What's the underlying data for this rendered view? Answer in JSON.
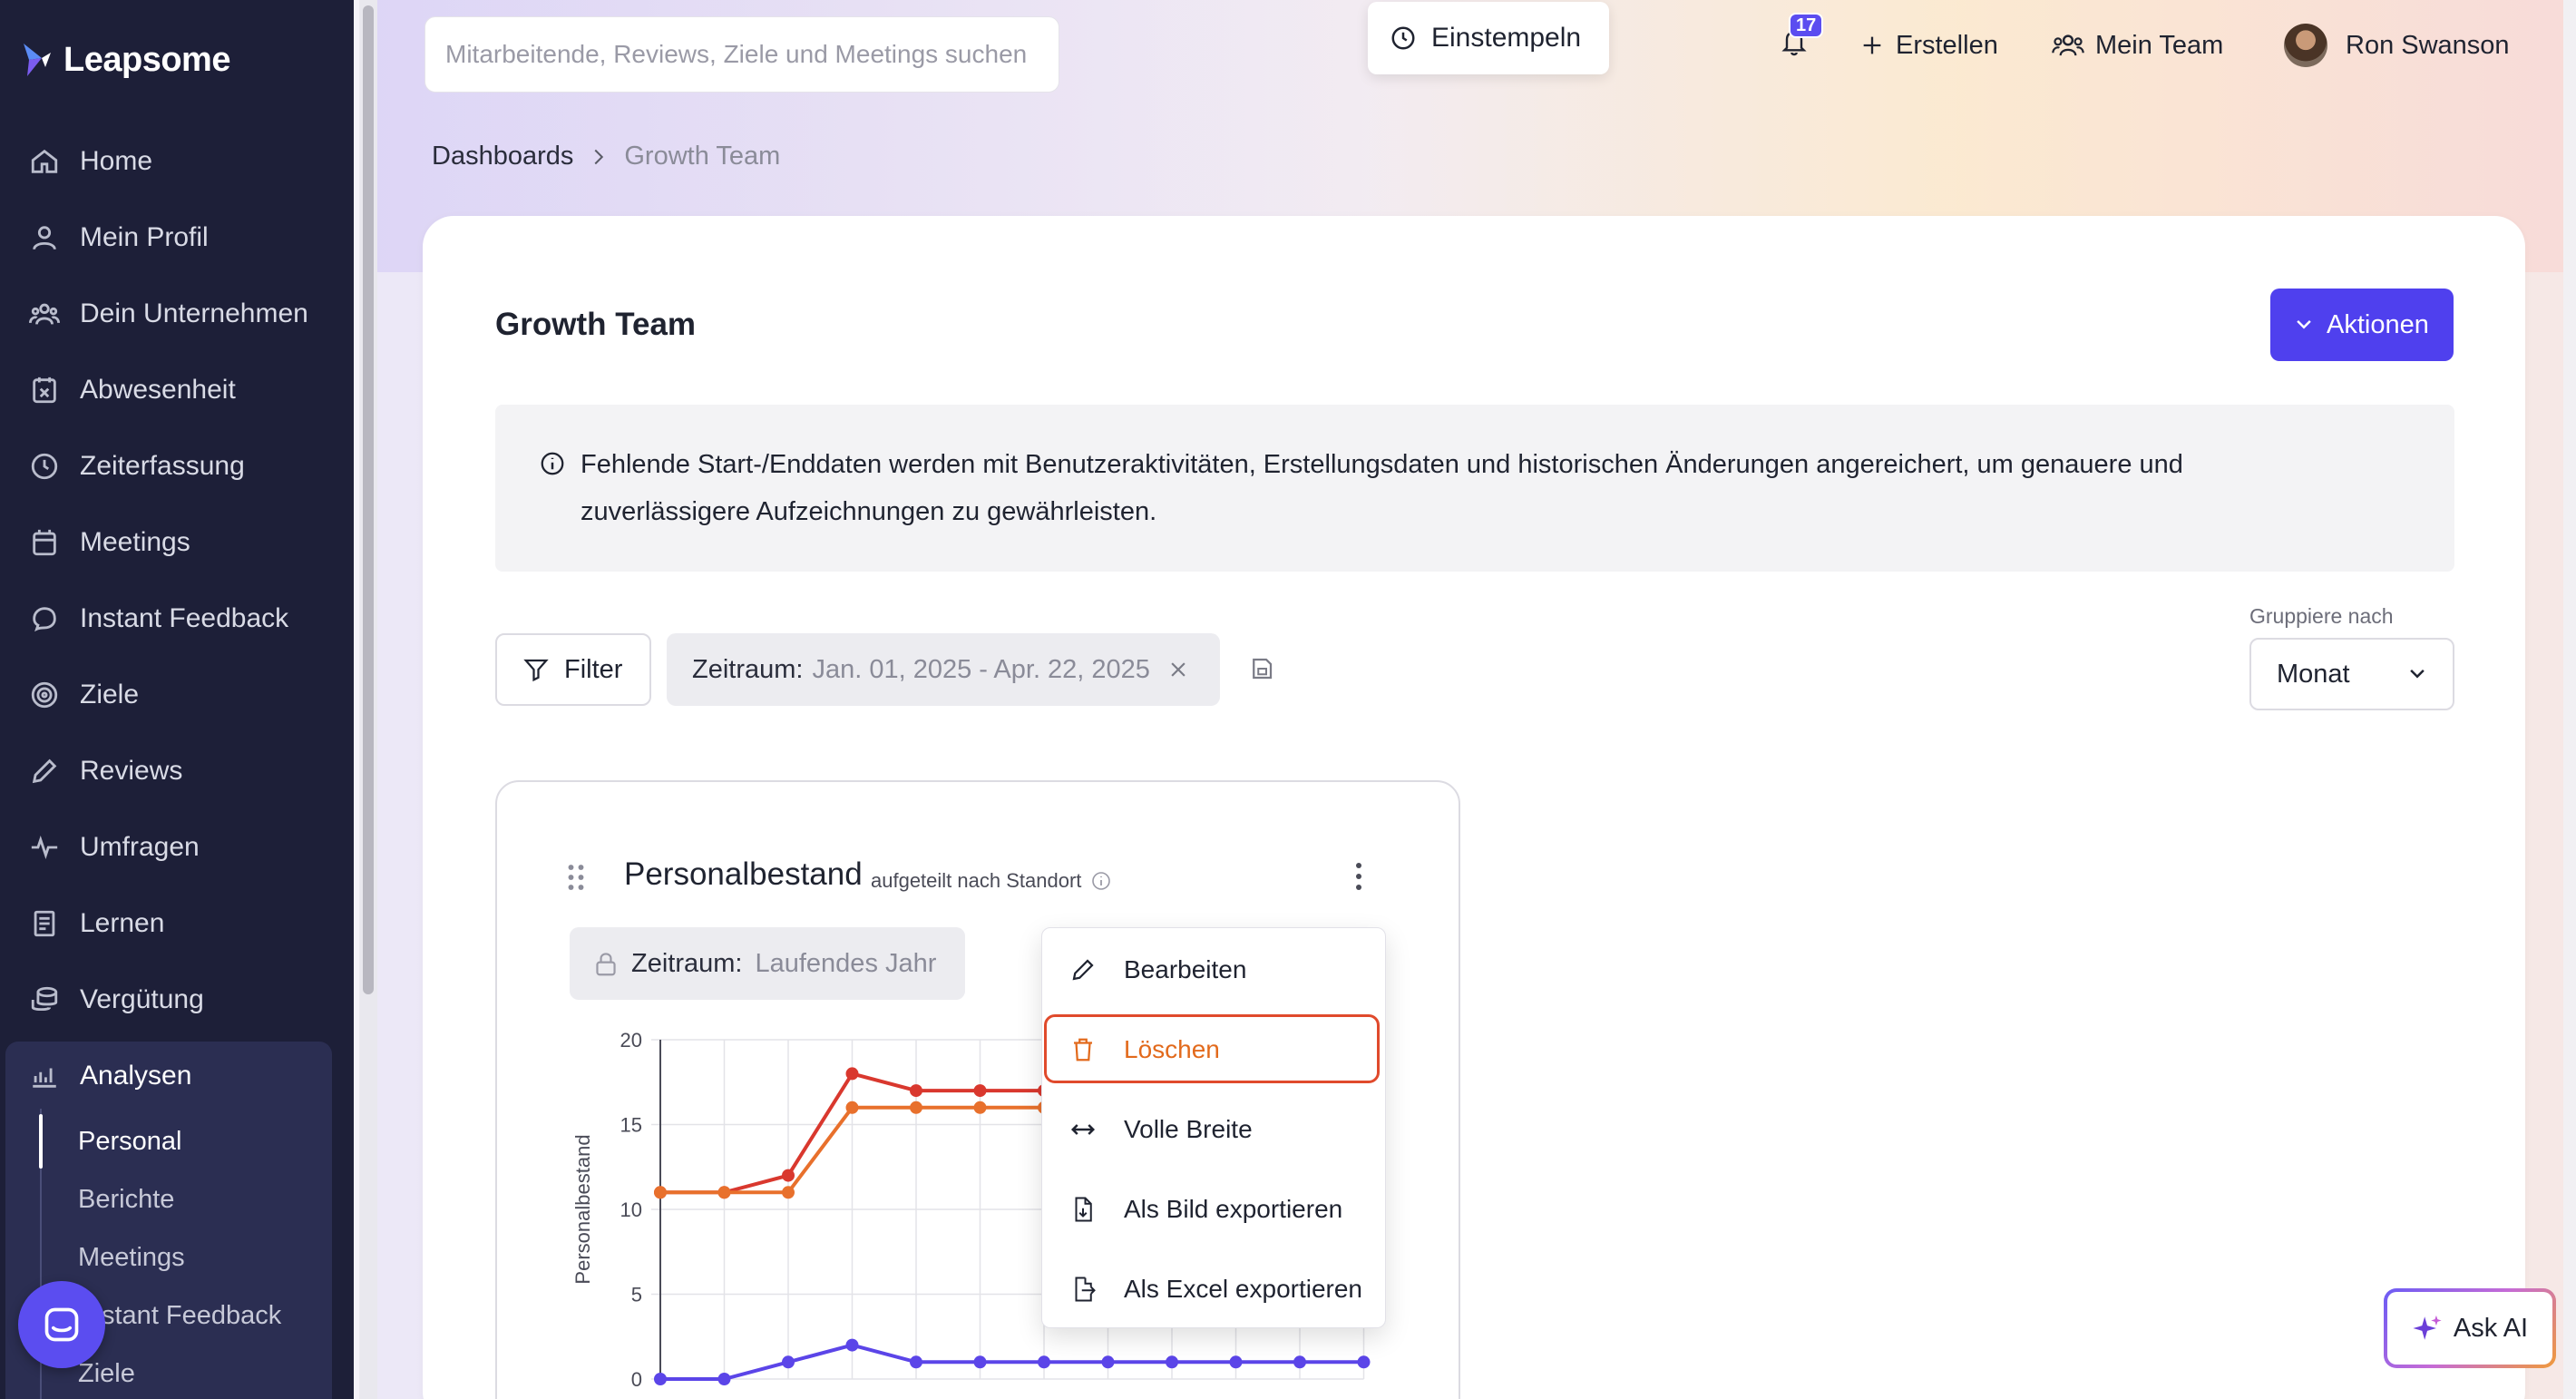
{
  "app": {
    "name": "Leapsome"
  },
  "sidebar": {
    "items": [
      {
        "label": "Home",
        "icon": "home-icon"
      },
      {
        "label": "Mein Profil",
        "icon": "user-icon"
      },
      {
        "label": "Dein Unternehmen",
        "icon": "users-icon"
      },
      {
        "label": "Abwesenheit",
        "icon": "calendar-x-icon"
      },
      {
        "label": "Zeiterfassung",
        "icon": "clock-icon"
      },
      {
        "label": "Meetings",
        "icon": "calendar-icon"
      },
      {
        "label": "Instant Feedback",
        "icon": "chat-icon"
      },
      {
        "label": "Ziele",
        "icon": "target-icon"
      },
      {
        "label": "Reviews",
        "icon": "pencil-icon"
      },
      {
        "label": "Umfragen",
        "icon": "pulse-icon"
      },
      {
        "label": "Lernen",
        "icon": "book-icon"
      },
      {
        "label": "Vergütung",
        "icon": "coins-icon"
      },
      {
        "label": "Analysen",
        "icon": "chart-icon"
      }
    ],
    "analysen_sub": [
      {
        "label": "Personal",
        "active": true
      },
      {
        "label": "Berichte"
      },
      {
        "label": "Meetings"
      },
      {
        "label": "Instant Feedback"
      },
      {
        "label": "Ziele"
      }
    ],
    "sub_item_3_visible": "stant Feedback"
  },
  "topbar": {
    "search_placeholder": "Mitarbeitende, Reviews, Ziele und Meetings suchen",
    "stamp_label": "Einstempeln",
    "notification_count": "17",
    "create_label": "Erstellen",
    "team_label": "Mein Team",
    "user_name": "Ron Swanson"
  },
  "breadcrumb": {
    "root": "Dashboards",
    "current": "Growth Team"
  },
  "page": {
    "title": "Growth Team",
    "actions_label": "Aktionen",
    "info_text": "Fehlende Start-/Enddaten werden mit Benutzeraktivitäten, Erstellungsdaten und historischen Änderungen angereichert, um genauere und zuverlässigere Aufzeichnungen zu gewährleisten.",
    "filter_label": "Filter",
    "zeitraum_label": "Zeitraum:",
    "zeitraum_value": "Jan. 01, 2025 - Apr. 22, 2025",
    "group_label": "Gruppiere nach",
    "group_value": "Monat"
  },
  "widget": {
    "title": "Personalbestand",
    "subtitle": "aufgeteilt nach Standort",
    "zeitraum_label": "Zeitraum:",
    "zeitraum_value": "Laufendes Jahr"
  },
  "menu": {
    "items": [
      {
        "label": "Bearbeiten",
        "icon": "pencil-icon"
      },
      {
        "label": "Löschen",
        "icon": "trash-icon",
        "danger": true
      },
      {
        "label": "Volle Breite",
        "icon": "arrows-horizontal-icon"
      },
      {
        "label": "Als Bild exportieren",
        "icon": "file-image-icon"
      },
      {
        "label": "Als Excel exportieren",
        "icon": "file-export-icon"
      }
    ]
  },
  "ask_ai": {
    "label": "Ask AI"
  },
  "colors": {
    "accent": "#4f40ee",
    "sidebar": "#1d1f38",
    "danger": "#e26a1c",
    "series_red": "#d9382e",
    "series_orange": "#e8702c",
    "series_purple": "#5b45e8"
  },
  "chart_data": {
    "type": "line",
    "ylabel": "Personalbestand",
    "ylim": [
      0,
      20
    ],
    "yticks": [
      0,
      5,
      10,
      15,
      20
    ],
    "grid": true,
    "series": [
      {
        "color": "#d9382e",
        "values": [
          11,
          11,
          12,
          18,
          17,
          17,
          17
        ]
      },
      {
        "color": "#e8702c",
        "values": [
          11,
          11,
          11,
          16,
          16,
          16,
          16
        ]
      },
      {
        "color": "#5b45e8",
        "values": [
          0,
          0,
          1,
          2,
          1,
          1,
          1,
          1,
          1,
          1,
          1,
          1
        ]
      }
    ]
  }
}
